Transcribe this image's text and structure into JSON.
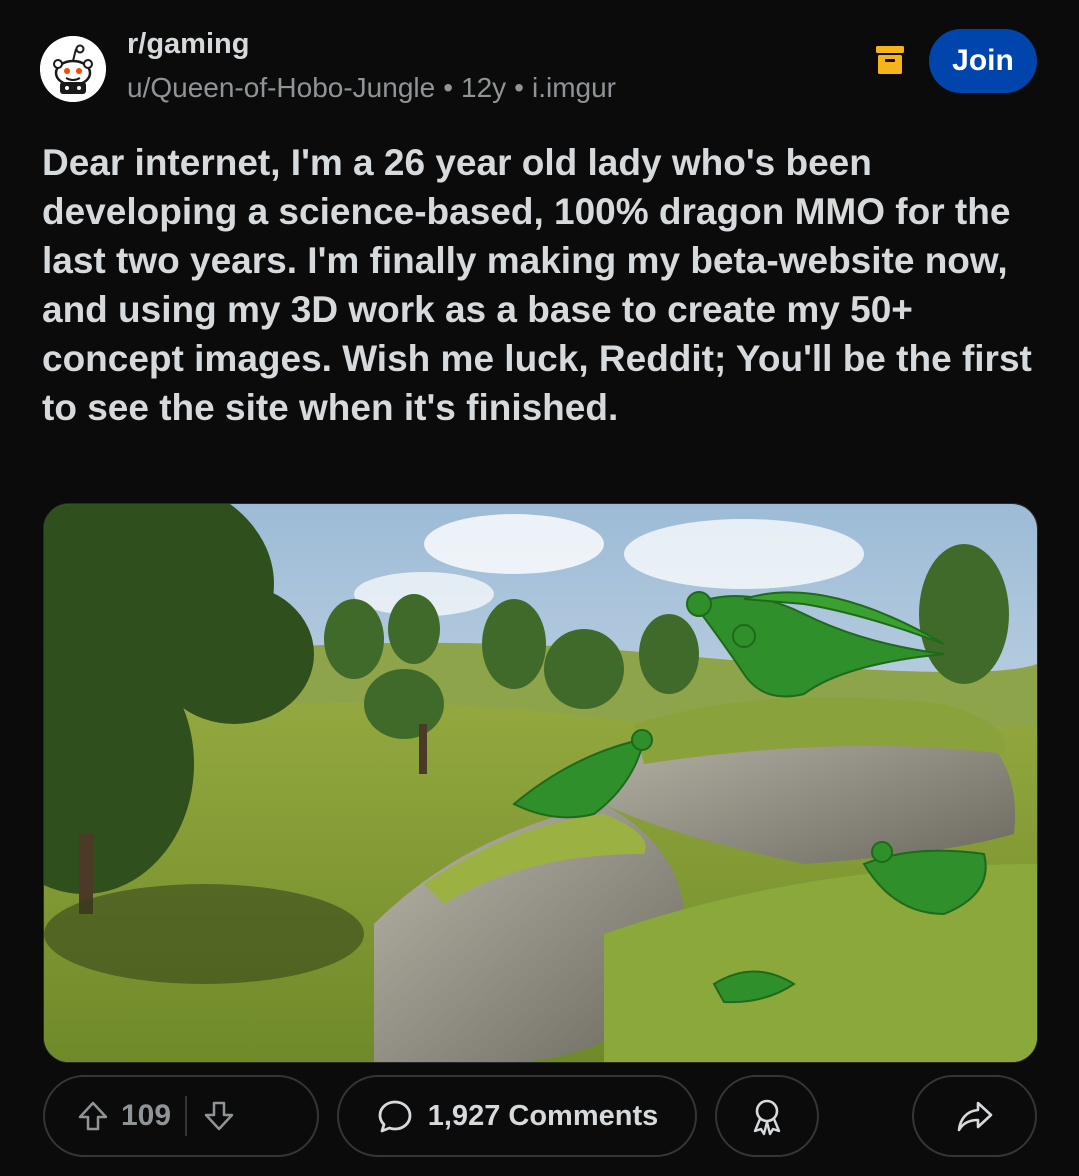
{
  "post": {
    "subreddit": "r/gaming",
    "author": "u/Queen-of-Hobo-Jungle",
    "age": "12y",
    "domain": "i.imgur",
    "separator": "•",
    "title": "Dear internet, I'm a 26 year old lady who's been developing a science-based, 100% dragon MMO for the last two years. I'm finally making my beta-website now, and using my 3D work as a base to create my 50+ concept images. Wish me luck, Reddit; You'll be the first to see the site when it's finished.",
    "join_label": "Join",
    "image_alt": "3D render of green dragons on grassy hills and rocks with trees"
  },
  "actions": {
    "score": "109",
    "comments_label": "1,927 Comments"
  },
  "icons": {
    "avatar": "reddit-snoo-icon",
    "archive": "archive-box-icon",
    "upvote": "upvote-arrow-icon",
    "downvote": "downvote-arrow-icon",
    "comment": "comment-bubble-icon",
    "award": "award-ribbon-icon",
    "share": "share-arrow-icon"
  },
  "colors": {
    "background": "#0b0b0b",
    "join_button": "#0045ac",
    "archive_icon": "#f4b41a",
    "text_primary": "#d7dadc",
    "text_secondary": "#8f9497"
  }
}
